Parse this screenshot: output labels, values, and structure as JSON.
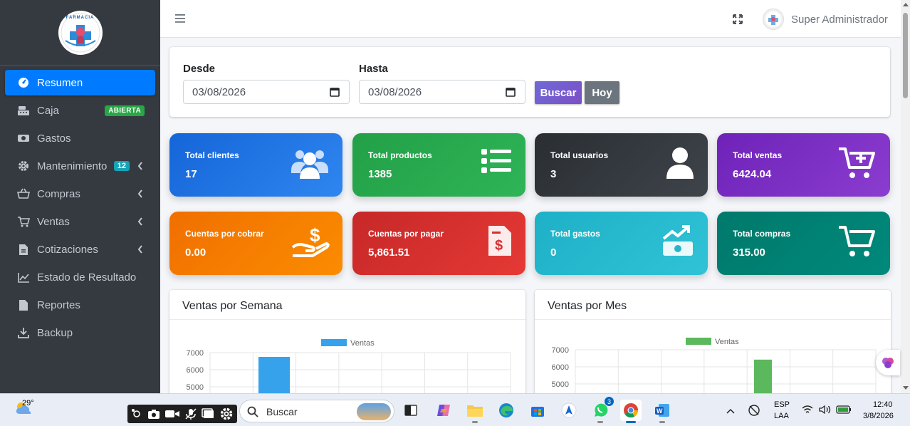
{
  "sidebar": {
    "logo_text": "FARMACIA",
    "items": [
      {
        "label": "Resumen",
        "icon": "dashboard-icon",
        "active": true
      },
      {
        "label": "Caja",
        "icon": "cash-register-icon",
        "badge": "ABIERTA"
      },
      {
        "label": "Gastos",
        "icon": "money-bill-icon"
      },
      {
        "label": "Mantenimiento",
        "icon": "gear-icon",
        "badge": "12"
      },
      {
        "label": "Compras",
        "icon": "basket-icon"
      },
      {
        "label": "Ventas",
        "icon": "cart-icon"
      },
      {
        "label": "Cotizaciones",
        "icon": "file-invoice-icon"
      },
      {
        "label": "Estado de Resultado",
        "icon": "line-chart-icon"
      },
      {
        "label": "Reportes",
        "icon": "file-icon"
      },
      {
        "label": "Backup",
        "icon": "download-icon"
      }
    ]
  },
  "topbar": {
    "user_name": "Super Administrador"
  },
  "filters": {
    "desde_label": "Desde",
    "desde_value": "03/08/2026",
    "hasta_label": "Hasta",
    "hasta_value": "03/08/2026",
    "buscar_label": "Buscar",
    "hoy_label": "Hoy"
  },
  "stats": [
    {
      "label": "Total clientes",
      "value": "17",
      "color": "#1e6fe0",
      "icon": "users-icon"
    },
    {
      "label": "Total productos",
      "value": "1385",
      "color": "#28a745",
      "icon": "list-icon"
    },
    {
      "label": "Total usuarios",
      "value": "3",
      "color": "#343a40",
      "icon": "user-icon"
    },
    {
      "label": "Total ventas",
      "value": "6424.04",
      "color": "#7b2fbe",
      "icon": "cart-plus-icon"
    },
    {
      "label": "Cuentas por cobrar",
      "value": "0.00",
      "color": "#f57c00",
      "icon": "hand-dollar-icon"
    },
    {
      "label": "Cuentas por pagar",
      "value": "5,861.51",
      "color": "#d32f2f",
      "icon": "invoice-dollar-icon"
    },
    {
      "label": "Total gastos",
      "value": "0",
      "color": "#26b5c8",
      "icon": "money-trend-icon"
    },
    {
      "label": "Total compras",
      "value": "315.00",
      "color": "#00897b",
      "icon": "cart-icon"
    }
  ],
  "chart_data": [
    {
      "type": "bar",
      "title": "Ventas por Semana",
      "series": [
        {
          "name": "Ventas",
          "values": [
            6750
          ],
          "color": "#36a2eb"
        }
      ],
      "y_ticks": [
        "7000",
        "6000",
        "5000"
      ],
      "ylim": [
        5000,
        7000
      ],
      "grid": true,
      "legend": "top"
    },
    {
      "type": "bar",
      "title": "Ventas por Mes",
      "series": [
        {
          "name": "Ventas",
          "values": [
            6424.04
          ],
          "color": "#5cb85c"
        }
      ],
      "y_ticks": [
        "7000",
        "6000",
        "5000"
      ],
      "ylim": [
        5000,
        7000
      ],
      "grid": true,
      "legend": "top"
    }
  ],
  "taskbar": {
    "temperature": "29°",
    "search_placeholder": "Buscar",
    "language_top": "ESP",
    "language_bottom": "LAA",
    "time": "12:40",
    "date": "3/8/2026",
    "whatsapp_badge": "3"
  }
}
